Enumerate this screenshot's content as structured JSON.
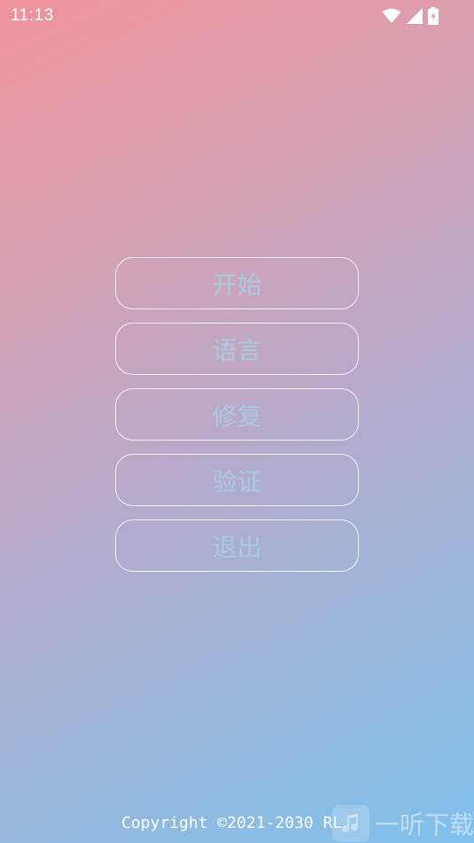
{
  "status_bar": {
    "time": "11:13",
    "icons": [
      "wifi-icon",
      "signal-icon",
      "battery-charging-icon"
    ]
  },
  "menu": {
    "buttons": [
      {
        "label": "开始"
      },
      {
        "label": "语言"
      },
      {
        "label": "修复"
      },
      {
        "label": "验证"
      },
      {
        "label": "退出"
      }
    ]
  },
  "footer": {
    "copyright": "Copyright ©2021-2030 RL"
  },
  "watermark": {
    "text": "一听下载"
  },
  "colors": {
    "gradient_top": "#f0939c",
    "gradient_bottom": "#7fc0ec",
    "button_text": "#a9cbe0",
    "button_border": "#ffffff"
  }
}
